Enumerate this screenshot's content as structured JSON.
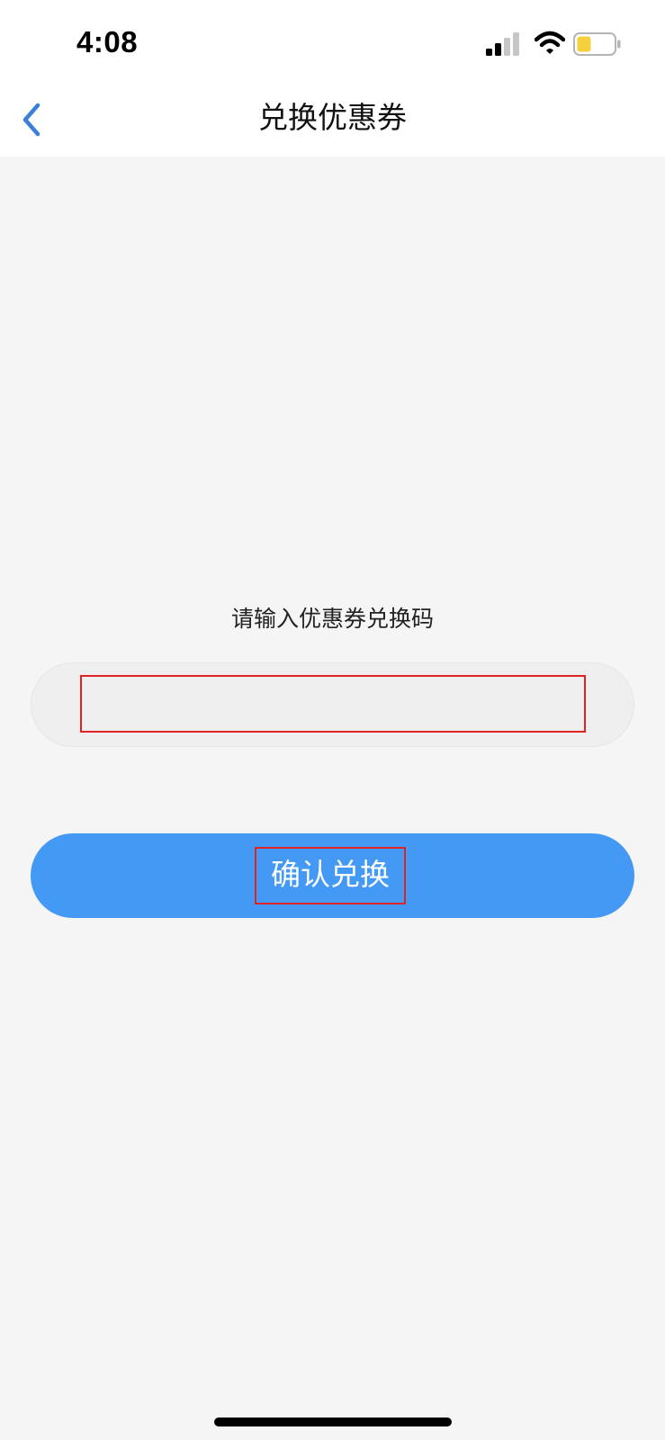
{
  "status_bar": {
    "time": "4:08",
    "icons": [
      "signal-icon",
      "wifi-icon",
      "battery-icon"
    ],
    "battery_color": "#f5d03c"
  },
  "nav": {
    "back_icon": "chevron-left-icon",
    "title": "兑换优惠券",
    "accent_color": "#3a7fd9"
  },
  "form": {
    "prompt": "请输入优惠券兑换码",
    "code_value": "",
    "confirm_label": "确认兑换",
    "button_color": "#4499f5"
  }
}
